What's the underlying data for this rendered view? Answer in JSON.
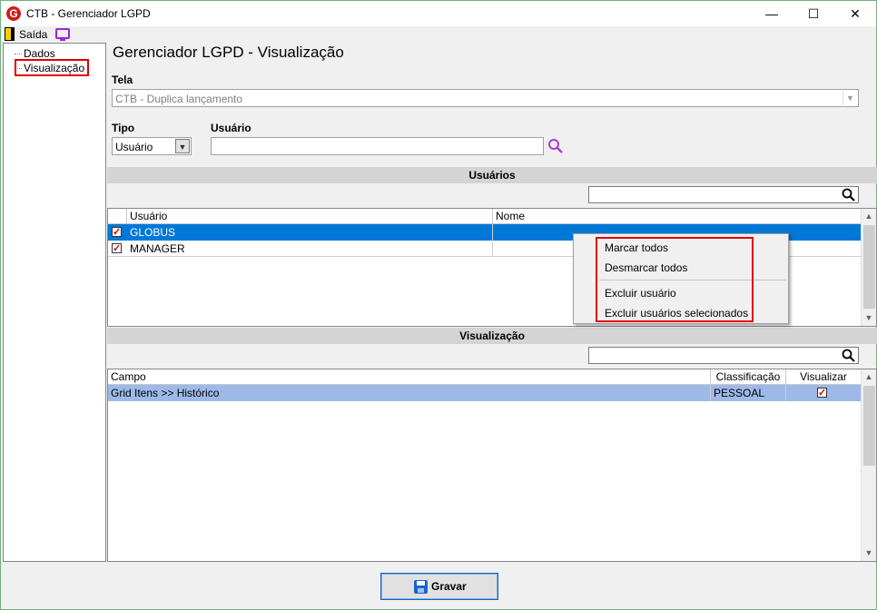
{
  "window": {
    "title": "CTB - Gerenciador LGPD",
    "app_icon": "G",
    "minimize": "—",
    "maximize": "☐",
    "close": "✕"
  },
  "menu": {
    "exit_label": "Saída",
    "exit_icon": "exit-door-icon",
    "screen_icon": "monitor-icon"
  },
  "tree": {
    "items": [
      {
        "label": "Dados"
      },
      {
        "label": "Visualização",
        "selected": true
      }
    ]
  },
  "page": {
    "title": "Gerenciador LGPD - Visualização"
  },
  "form": {
    "tela_label": "Tela",
    "tela_value": "CTB - Duplica lançamento",
    "tipo_label": "Tipo",
    "tipo_value": "Usuário",
    "usuario_label": "Usuário",
    "usuario_value": ""
  },
  "usuarios_section": {
    "title": "Usuários",
    "search_value": "",
    "columns": [
      "Usuário",
      "Nome"
    ],
    "rows": [
      {
        "checked": true,
        "usuario": "GLOBUS",
        "nome": "",
        "selected": true
      },
      {
        "checked": true,
        "usuario": "MANAGER",
        "nome": "",
        "selected": false
      }
    ]
  },
  "context_menu": {
    "items": [
      "Marcar todos",
      "Desmarcar todos",
      "Excluir usuário",
      "Excluir usuários selecionados"
    ]
  },
  "visualizacao_section": {
    "title": "Visualização",
    "search_value": "",
    "columns": [
      "Campo",
      "Classificação",
      "Visualizar"
    ],
    "rows": [
      {
        "campo": "Grid Itens >> Histórico",
        "classificacao": "PESSOAL",
        "visualizar": true
      }
    ]
  },
  "footer": {
    "save_label": "Gravar",
    "save_icon": "floppy-disk-icon"
  },
  "colors": {
    "selection_blue": "#0078d7",
    "row_highlight": "#9db9e8",
    "highlight_red": "#e00000",
    "section_bar": "#d4d4d4"
  }
}
